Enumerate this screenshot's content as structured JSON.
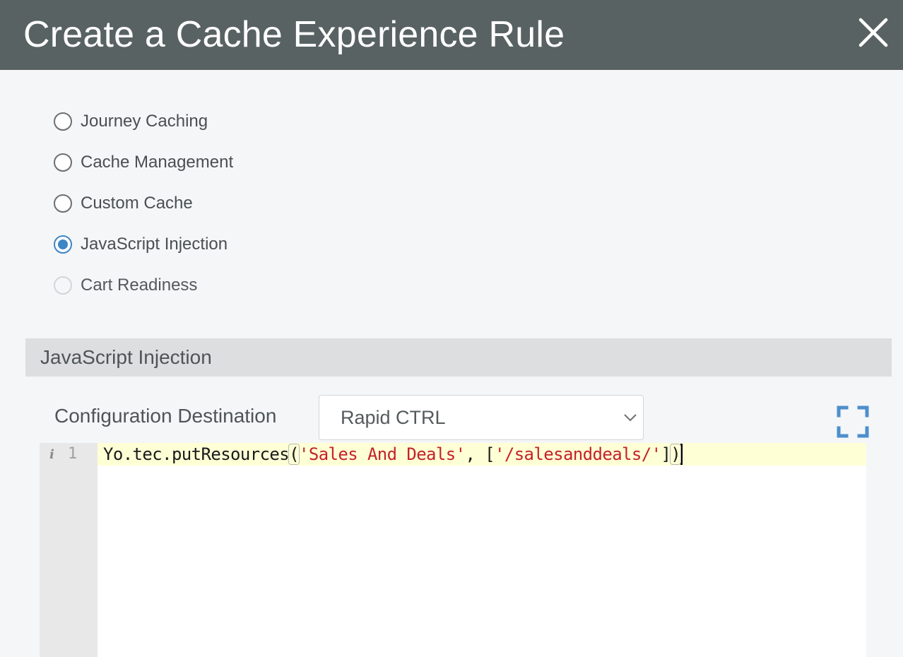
{
  "dialog": {
    "title": "Create a Cache Experience Rule",
    "close_icon": "close-icon"
  },
  "rule_types": [
    {
      "label": "Journey Caching",
      "checked": false,
      "disabled": false
    },
    {
      "label": "Cache Management",
      "checked": false,
      "disabled": false
    },
    {
      "label": "Custom Cache",
      "checked": false,
      "disabled": false
    },
    {
      "label": "JavaScript Injection",
      "checked": true,
      "disabled": false
    },
    {
      "label": "Cart Readiness",
      "checked": false,
      "disabled": true
    }
  ],
  "section": {
    "title": "JavaScript Injection"
  },
  "config": {
    "label": "Configuration Destination",
    "selected": "Rapid CTRL",
    "expand_icon": "expand-icon"
  },
  "editor": {
    "line_info_icon": "info-icon",
    "line_number": "1",
    "code": {
      "part1": "Yo.tec.putResources",
      "open_paren": "(",
      "str1": "'Sales And Deals'",
      "part2": ", [",
      "str2": "'/salesanddeals/'",
      "part3": "]",
      "close_paren": ")"
    }
  },
  "colors": {
    "header_bg": "#596262",
    "accent": "#3d86c6",
    "string": "#c4222a",
    "active_line": "#ffffd6"
  }
}
